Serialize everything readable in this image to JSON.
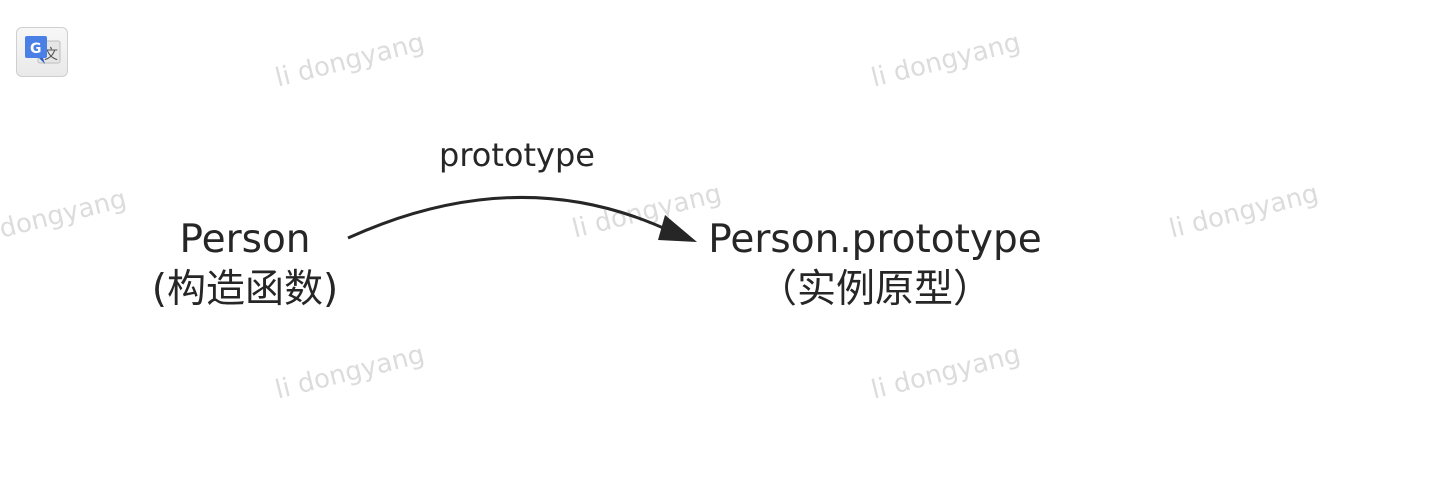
{
  "toolbar": {
    "translate_icon": "google-translate-icon",
    "translate_glyph_g": "G",
    "translate_glyph_wen": "文"
  },
  "watermark": {
    "text": "li dongyang",
    "partial_text": "dongyang"
  },
  "diagram": {
    "nodes": [
      {
        "id": "person",
        "name": "Person",
        "role": "(构造函数)"
      },
      {
        "id": "person-prototype",
        "name": "Person.prototype",
        "role": "（实例原型）"
      }
    ],
    "edges": [
      {
        "from": "person",
        "to": "person-prototype",
        "label": "prototype"
      }
    ]
  },
  "colors": {
    "text": "#262626",
    "arrow": "#262626",
    "watermark": "#dcdcdc",
    "translate_blue": "#4a7fe6"
  }
}
